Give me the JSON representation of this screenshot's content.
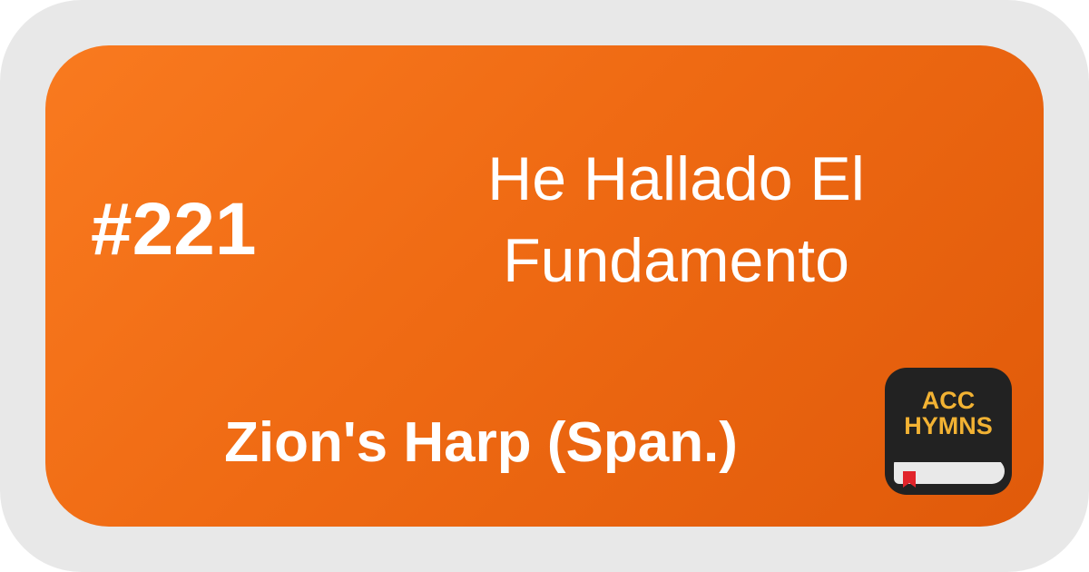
{
  "hymn": {
    "number": "#221",
    "title_line_1": "He Hallado El",
    "title_line_2": "Fundamento",
    "hymnal": "Zion's Harp (Span.)"
  },
  "app_badge": {
    "line_1": "ACC",
    "line_2": "HYMNS",
    "icon": "bookmark-icon"
  },
  "colors": {
    "card_orange_start": "#f97a1f",
    "card_orange_end": "#e05a0a",
    "frame_gray": "#e8e8e8",
    "badge_text_gold": "#f2b233",
    "badge_background": "#222222",
    "bookmark_red": "#e1242b"
  }
}
